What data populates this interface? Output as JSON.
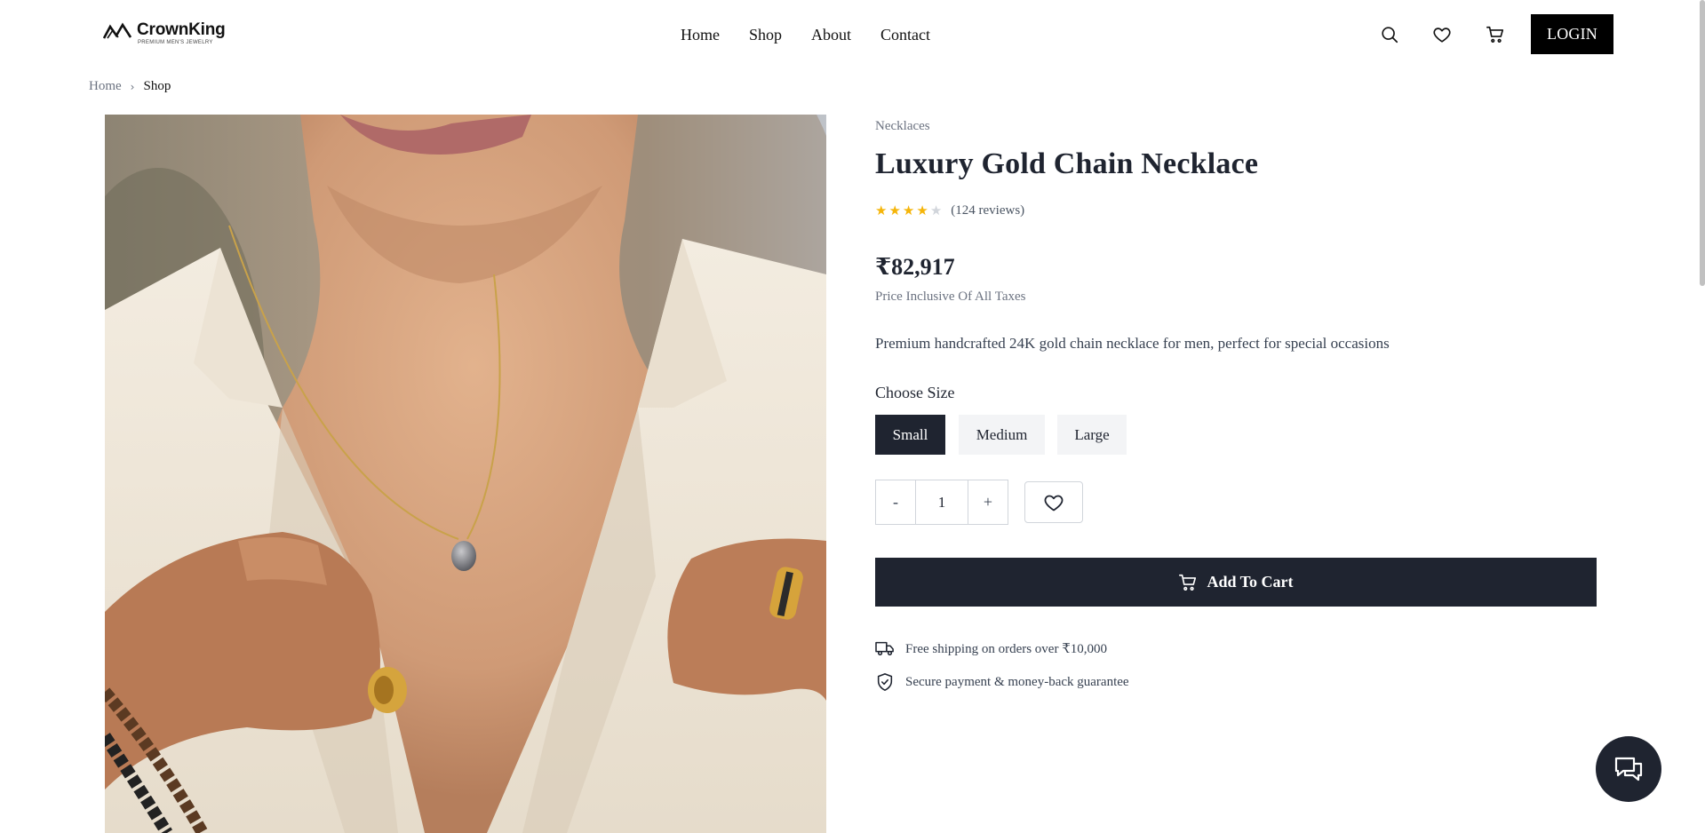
{
  "brand": {
    "name": "CrownKing",
    "tagline": "PREMIUM MEN'S JEWELRY"
  },
  "nav": {
    "items": [
      {
        "label": "Home"
      },
      {
        "label": "Shop"
      },
      {
        "label": "About"
      },
      {
        "label": "Contact"
      }
    ]
  },
  "header": {
    "icons": [
      "search-icon",
      "heart-icon",
      "cart-icon"
    ],
    "login_label": "LOGIN"
  },
  "breadcrumb": {
    "home": "Home",
    "current": "Shop"
  },
  "product": {
    "category": "Necklaces",
    "title": "Luxury Gold Chain Necklace",
    "rating": 4,
    "rating_max": 5,
    "reviews": "(124 reviews)",
    "price": "₹82,917",
    "tax_note": "Price Inclusive Of All Taxes",
    "description": "Premium handcrafted 24K gold chain necklace for men, perfect for special occasions",
    "size_label": "Choose Size",
    "sizes": [
      {
        "label": "Small",
        "selected": true
      },
      {
        "label": "Medium",
        "selected": false
      },
      {
        "label": "Large",
        "selected": false
      }
    ],
    "quantity": {
      "minus": "-",
      "value": "1",
      "plus": "+"
    },
    "add_to_cart": "Add To Cart",
    "perks": [
      {
        "icon": "truck-icon",
        "text": "Free shipping on orders over ₹10,000"
      },
      {
        "icon": "shield-check-icon",
        "text": "Secure payment & money-back guarantee"
      }
    ]
  },
  "colors": {
    "primary_dark": "#1f2430",
    "star": "#f5b50a",
    "muted": "#6b7280"
  }
}
